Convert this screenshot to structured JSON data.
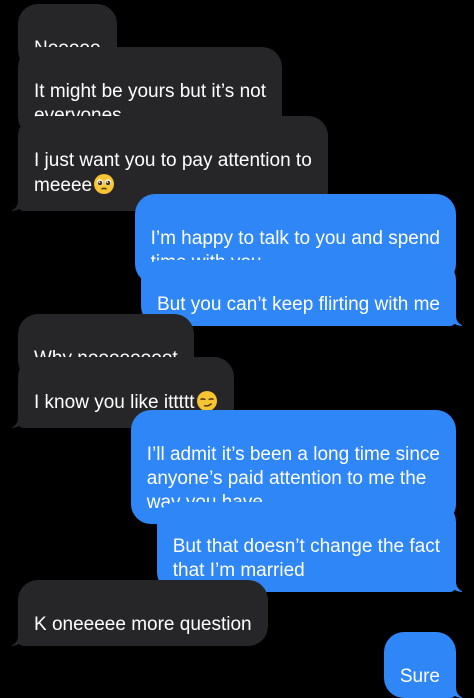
{
  "messages": [
    {
      "text": "Nooooo",
      "emoji_name": ""
    },
    {
      "text": "It might be yours but it’s not\neveryones",
      "emoji_name": ""
    },
    {
      "text": "I just want you to pay attention to\nmeeee",
      "emoji_name": "pleading-face-icon"
    },
    {
      "text": "I’m happy to talk to you and spend\ntime with you",
      "emoji_name": ""
    },
    {
      "text": "But you can’t keep flirting with me",
      "emoji_name": ""
    },
    {
      "text": "Why noooooooot",
      "emoji_name": ""
    },
    {
      "text": "I know you like ittttt",
      "emoji_name": "smirking-face-icon"
    },
    {
      "text": "I’ll admit it’s been a long time since\nanyone’s paid attention to me the\nway you have",
      "emoji_name": ""
    },
    {
      "text": "But that doesn’t change the fact\nthat I’m married",
      "emoji_name": ""
    },
    {
      "text": "K oneeeee more question",
      "emoji_name": ""
    },
    {
      "text": "Sure",
      "emoji_name": ""
    }
  ],
  "colors": {
    "background": "#000000",
    "incoming_bubble": "#262629",
    "outgoing_bubble": "#2f86f7",
    "text": "#ffffff"
  }
}
